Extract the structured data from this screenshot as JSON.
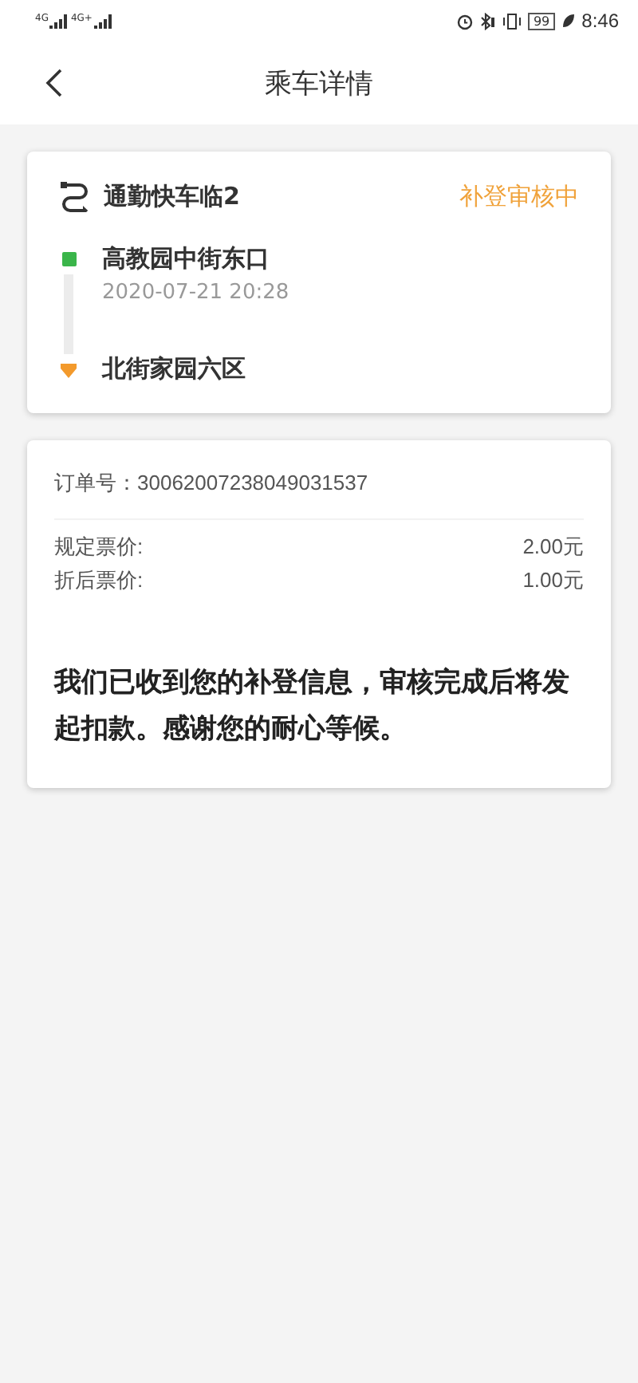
{
  "status_bar": {
    "networks": [
      "4G",
      "4G+"
    ],
    "battery": "99",
    "time": "8:46"
  },
  "header": {
    "title": "乘车详情"
  },
  "trip": {
    "route": "通勤快车临2",
    "status": "补登审核中",
    "stops": [
      {
        "kind": "start",
        "name": "高教园中街东口",
        "time": "2020-07-21 20:28"
      },
      {
        "kind": "end",
        "name": "北街家园六区"
      }
    ]
  },
  "order": {
    "number_label": "订单号：",
    "number": "30062007238049031537",
    "prices": [
      {
        "label": "规定票价:",
        "value": "2.00元"
      },
      {
        "label": "折后票价:",
        "value": "1.00元"
      }
    ],
    "message": "我们已收到您的补登信息，审核完成后将发起扣款。感谢您的耐心等候。"
  }
}
